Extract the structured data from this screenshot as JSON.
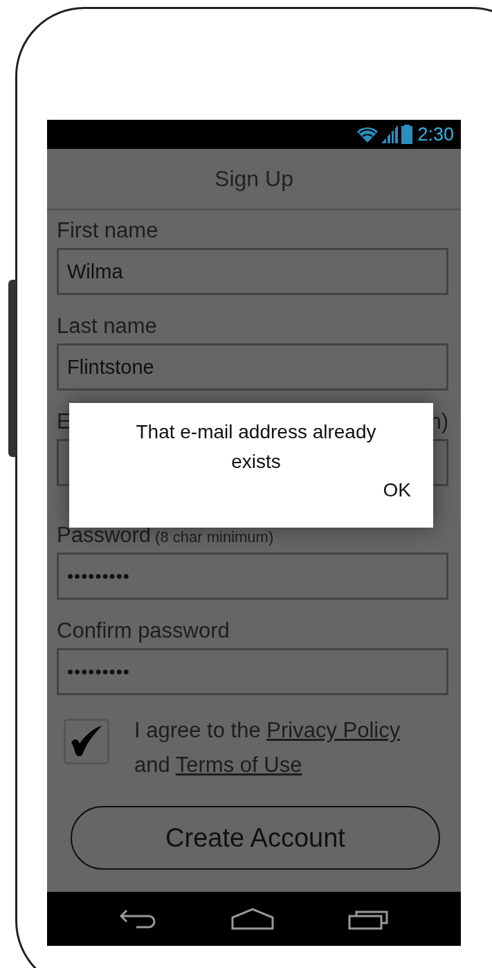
{
  "status_bar": {
    "time": "2:30"
  },
  "title": "Sign Up",
  "fields": [
    {
      "kind": "text",
      "label": "First name",
      "value": "Wilma"
    },
    {
      "kind": "text",
      "label": "Last name",
      "value": "Flintstone"
    },
    {
      "kind": "text",
      "label": "E",
      "label_end": "n)"
    },
    {
      "kind": "password",
      "label": "Password",
      "hint": "(8 char minimum)",
      "value": "•••••••••"
    },
    {
      "kind": "password",
      "label": "Confirm password",
      "value": "•••••••••"
    }
  ],
  "agreement": {
    "checked": true,
    "text_before": "I agree to the",
    "privacy_link": "Privacy Policy",
    "text_middle": "and",
    "terms_link": "Terms of Use"
  },
  "create_button": "Create Account",
  "dialog": {
    "message": "That e-mail address already exists",
    "button": "OK"
  }
}
